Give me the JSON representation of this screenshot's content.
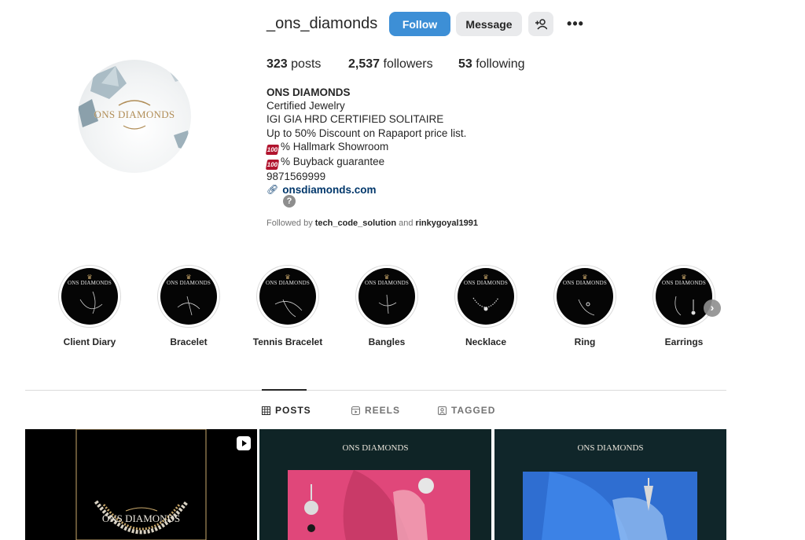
{
  "profile": {
    "username": "_ons_diamonds",
    "avatar_brand": "ONS DIAMONDS",
    "buttons": {
      "follow": "Follow",
      "message": "Message"
    },
    "stats": {
      "posts_count": "323",
      "posts_label": "posts",
      "followers_count": "2,537",
      "followers_label": "followers",
      "following_count": "53",
      "following_label": "following"
    },
    "bio": {
      "name": "ONS DIAMONDS",
      "line1": "Certified Jewelry",
      "line2": "IGI GIA HRD CERTIFIED SOLITAIRE",
      "line3": "Up to 50% Discount on Rapaport price list.",
      "line4": "% Hallmark Showroom",
      "line5": "% Buyback guarantee",
      "phone": "9871569999",
      "link": "onsdiamonds.com"
    },
    "followed_by": {
      "prefix": "Followed by",
      "user1": "tech_code_solution",
      "conjunction": "and",
      "user2": "rinkygoyal1991"
    }
  },
  "highlights": [
    {
      "label": "Client Diary",
      "brand": "ONS DIAMONDS"
    },
    {
      "label": "Bracelet",
      "brand": "ONS DIAMONDS"
    },
    {
      "label": "Tennis Bracelet",
      "brand": "ONS DIAMONDS"
    },
    {
      "label": "Bangles",
      "brand": "ONS DIAMONDS"
    },
    {
      "label": "Necklace",
      "brand": "ONS DIAMONDS"
    },
    {
      "label": "Ring",
      "brand": "ONS DIAMONDS"
    },
    {
      "label": "Earrings",
      "brand": "ONS DIAMONDS"
    }
  ],
  "tabs": [
    {
      "label": "POSTS",
      "icon": "grid-icon",
      "active": true
    },
    {
      "label": "REELS",
      "icon": "reels-icon",
      "active": false
    },
    {
      "label": "TAGGED",
      "icon": "tagged-icon",
      "active": false
    }
  ],
  "posts": [
    {
      "brand": "ONS DIAMONDS",
      "type": "reel"
    },
    {
      "brand": "ONS DIAMONDS",
      "type": "image"
    },
    {
      "brand": "ONS DIAMONDS",
      "type": "image"
    }
  ],
  "colors": {
    "follow_button": "#3d8fd6",
    "secondary_button": "#e9eaec",
    "link": "#00376b",
    "gold": "#c9a86b"
  }
}
